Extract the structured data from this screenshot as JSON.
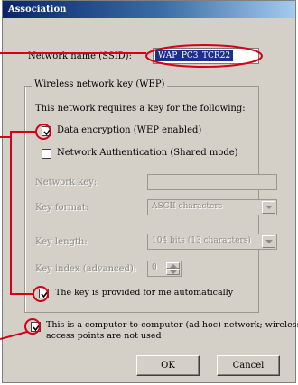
{
  "window": {
    "title": "Association"
  },
  "ssid": {
    "label": "Network name (SSID):",
    "value": "WAP_PC3_TCR22"
  },
  "wep_group": {
    "title": "Wireless network key (WEP)",
    "description": "This network requires a key for the following:",
    "data_encryption": {
      "label": "Data encryption (WEP enabled)",
      "checked": true
    },
    "shared_auth": {
      "label": "Network Authentication (Shared mode)",
      "checked": false
    },
    "network_key": {
      "label": "Network key:",
      "value": ""
    },
    "key_format": {
      "label": "Key format:",
      "value": "ASCII characters"
    },
    "key_length": {
      "label": "Key length:",
      "value": "104 bits (13 characters)"
    },
    "key_index": {
      "label": "Key index (advanced):",
      "value": "0"
    },
    "auto_key": {
      "label": "The key is provided for me automatically",
      "checked": true
    }
  },
  "adhoc": {
    "line1": "This is a computer-to-computer (ad hoc) network; wireless",
    "line2": "access points are not used",
    "checked": true
  },
  "buttons": {
    "ok": "OK",
    "cancel": "Cancel"
  },
  "annotation_color": "#d4001a"
}
